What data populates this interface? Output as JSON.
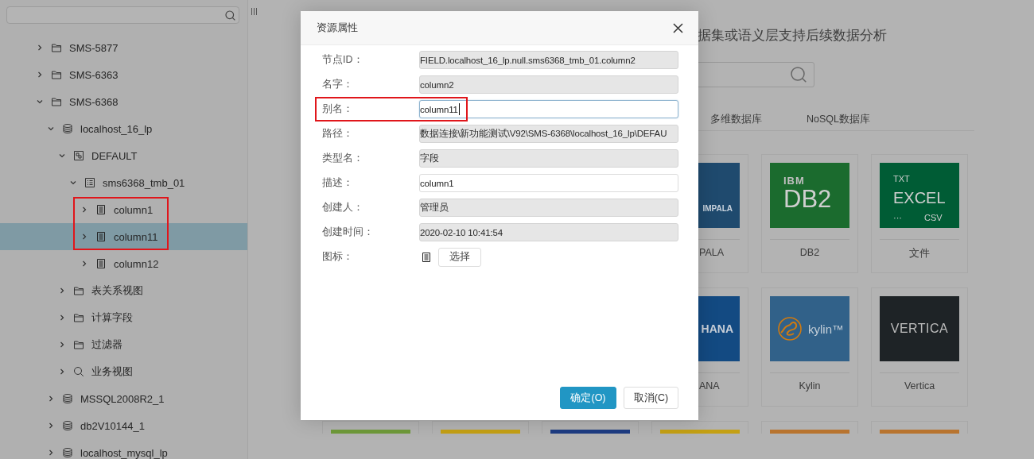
{
  "sidebar": {
    "tree": [
      {
        "kind": "folder",
        "label": "SMS-5877",
        "expanded": false,
        "selected": false
      },
      {
        "kind": "folder",
        "label": "SMS-6363",
        "expanded": false,
        "selected": false
      },
      {
        "kind": "folder",
        "label": "SMS-6368",
        "expanded": true,
        "selected": false,
        "children": [
          {
            "kind": "database",
            "label": "localhost_16_lp",
            "expanded": true,
            "selected": false,
            "children": [
              {
                "kind": "schema",
                "label": "DEFAULT",
                "expanded": true,
                "selected": false,
                "children": [
                  {
                    "kind": "table",
                    "label": "sms6368_tmb_01",
                    "expanded": true,
                    "selected": false,
                    "children": [
                      {
                        "kind": "column",
                        "label": "column1",
                        "expanded": false,
                        "selected": false,
                        "highlighted": true
                      },
                      {
                        "kind": "column",
                        "label": "column11",
                        "expanded": false,
                        "selected": true,
                        "highlighted": true
                      },
                      {
                        "kind": "column",
                        "label": "column12",
                        "expanded": false,
                        "selected": false,
                        "highlighted": false
                      }
                    ]
                  }
                ]
              },
              {
                "kind": "folder",
                "label": "表关系视图",
                "expanded": false,
                "selected": false
              },
              {
                "kind": "folder",
                "label": "计算字段",
                "expanded": false,
                "selected": false
              },
              {
                "kind": "folder",
                "label": "过滤器",
                "expanded": false,
                "selected": false
              },
              {
                "kind": "view",
                "label": "业务视图",
                "expanded": false,
                "selected": false
              }
            ]
          },
          {
            "kind": "database",
            "label": "MSSQL2008R2_1",
            "expanded": false,
            "selected": false
          },
          {
            "kind": "database",
            "label": "db2V10144_1",
            "expanded": false,
            "selected": false
          },
          {
            "kind": "database",
            "label": "localhost_mysql_lp",
            "expanded": false,
            "selected": false
          }
        ]
      }
    ]
  },
  "main": {
    "heading": "据集或语义层支持后续数据分析",
    "tabs": [
      {
        "label": "多维数据库",
        "selected": false
      },
      {
        "label": "NoSQL数据库",
        "selected": false
      }
    ],
    "card_rows": [
      [
        {
          "kind": "impala",
          "clipped": true,
          "color": "#1f4a6e",
          "logo_texts": [
            "IMPALA"
          ],
          "label": "PALA"
        },
        {
          "kind": "db2",
          "clipped": false,
          "color": "#1b6b2e",
          "logo_texts": [
            "IBM",
            "DB2"
          ],
          "label": "DB2"
        },
        {
          "kind": "file",
          "clipped": false,
          "color": "#005c35",
          "logo_texts": [
            "TXT",
            "EXCEL",
            "···",
            "CSV"
          ],
          "label": "文件"
        }
      ],
      [
        {
          "kind": "hana",
          "clipped": true,
          "color": "#134a82",
          "logo_texts": [
            "HANA"
          ],
          "label": "ANA"
        },
        {
          "kind": "kylin",
          "clipped": false,
          "color": "#316189",
          "logo_texts": [
            "kylin™"
          ],
          "label": "Kylin"
        },
        {
          "kind": "vertica",
          "clipped": false,
          "color": "#1e2326",
          "logo_texts": [
            "VERTICA"
          ],
          "label": "Vertica"
        }
      ],
      [
        {
          "kind": "strip",
          "color": "#6f9a3a"
        },
        {
          "kind": "strip",
          "color": "#c4a014"
        },
        {
          "kind": "strip",
          "color": "#1d3c82"
        },
        {
          "kind": "strip",
          "color": "#c4a014"
        },
        {
          "kind": "strip",
          "color": "#b8742f"
        },
        {
          "kind": "strip",
          "color": "#b8742f"
        }
      ]
    ]
  },
  "dialog": {
    "title": "资源属性",
    "fields": [
      {
        "kind": "text",
        "label": "节点ID：",
        "value": "FIELD.localhost_16_lp.null.sms6368_tmb_01.column2",
        "readonly": true,
        "focused": false,
        "highlighted": false
      },
      {
        "kind": "text",
        "label": "名字：",
        "value": "column2",
        "readonly": true,
        "focused": false,
        "highlighted": false
      },
      {
        "kind": "text",
        "label": "别名：",
        "value": "column11",
        "readonly": false,
        "focused": true,
        "highlighted": true
      },
      {
        "kind": "text",
        "label": "路径：",
        "value": "数据连接\\新功能测试\\V92\\SMS-6368\\localhost_16_lp\\DEFAU",
        "readonly": true,
        "focused": false,
        "highlighted": false
      },
      {
        "kind": "text",
        "label": "类型名：",
        "value": "字段",
        "readonly": true,
        "focused": false,
        "highlighted": false
      },
      {
        "kind": "text",
        "label": "描述：",
        "value": "column1",
        "readonly": false,
        "focused": false,
        "highlighted": false
      },
      {
        "kind": "text",
        "label": "创建人：",
        "value": "管理员",
        "readonly": true,
        "focused": false,
        "highlighted": false
      },
      {
        "kind": "text",
        "label": "创建时间：",
        "value": "2020-02-10 10:41:54",
        "readonly": true,
        "focused": false,
        "highlighted": false
      },
      {
        "kind": "icon-picker",
        "label": "图标：",
        "button": "选择"
      }
    ],
    "buttons": [
      {
        "label": "确定(O)",
        "kind": "primary"
      },
      {
        "label": "取消(C)",
        "kind": "secondary"
      }
    ]
  }
}
